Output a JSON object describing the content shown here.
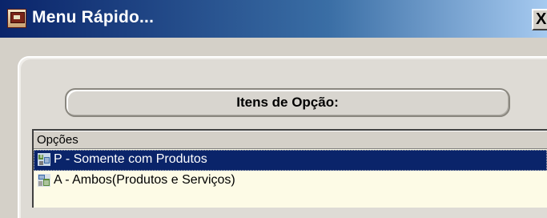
{
  "window": {
    "title": "Menu Rápido...",
    "close_label": "X",
    "app_icon": "app-window-icon"
  },
  "panel": {
    "header_label": "Itens de Opção:"
  },
  "list": {
    "column_header": "Opções",
    "items": [
      {
        "label": "P - Somente com Produtos",
        "icon": "products-icon",
        "selected": true
      },
      {
        "label": "A - Ambos(Produtos e Serviços)",
        "icon": "products-services-icon",
        "selected": false
      }
    ]
  },
  "colors": {
    "titlebar_start": "#0a246a",
    "titlebar_end": "#a6caf0",
    "selection": "#0a246a",
    "list_background": "#fdfbe6",
    "window_face": "#d4d0c8"
  }
}
